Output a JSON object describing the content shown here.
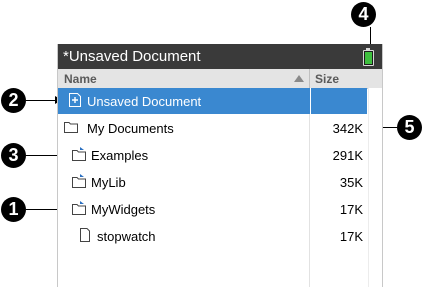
{
  "window": {
    "title": "*Unsaved Document",
    "battery_color": "#3fbf3f"
  },
  "columns": {
    "name": "Name",
    "size": "Size",
    "sort": "ascending"
  },
  "rows": [
    {
      "label": "Unsaved Document",
      "size": "",
      "icon": "document-new-icon",
      "selected": true
    },
    {
      "label": "My Documents",
      "size": "342K",
      "icon": "folder-icon",
      "selected": false
    },
    {
      "label": "Examples",
      "size": "291K",
      "icon": "folder-shortcut-icon",
      "selected": false
    },
    {
      "label": "MyLib",
      "size": "35K",
      "icon": "folder-shortcut-icon",
      "selected": false
    },
    {
      "label": "MyWidgets",
      "size": "17K",
      "icon": "folder-shortcut-icon",
      "selected": false
    },
    {
      "label": "stopwatch",
      "size": "17K",
      "icon": "file-icon",
      "selected": false
    }
  ],
  "callouts": [
    "1",
    "2",
    "3",
    "4",
    "5"
  ],
  "colors": {
    "selection": "#3a88d0",
    "titlebar": "#3a3a3a",
    "header": "#e4e4e4"
  }
}
